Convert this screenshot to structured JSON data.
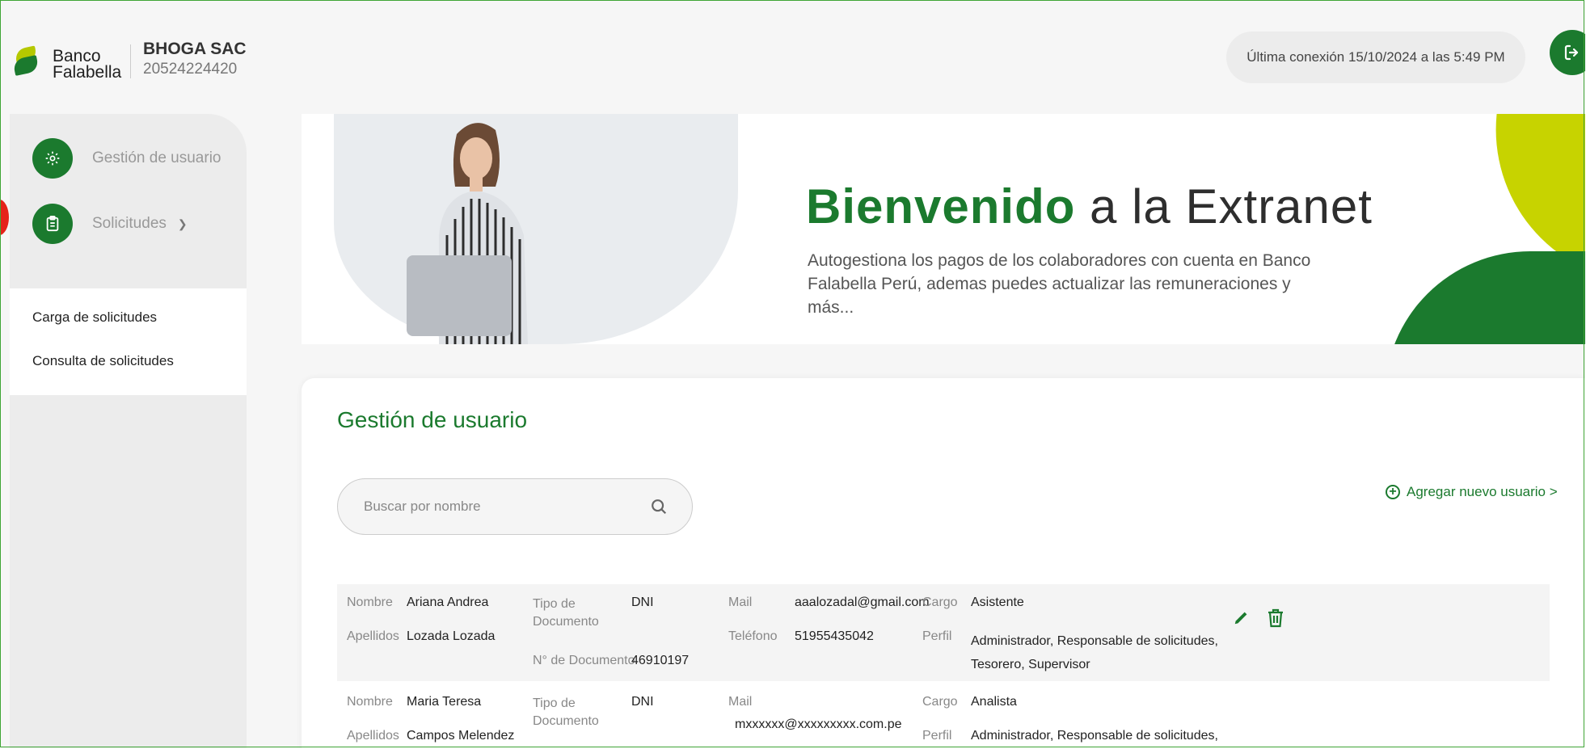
{
  "header": {
    "logo_line1": "Banco",
    "logo_line2": "Falabella",
    "company_name": "BHOGA SAC",
    "company_ruc": "20524224420",
    "last_connection": "Última conexión 15/10/2024 a las 5:49 PM",
    "logout_icon": "logout-icon"
  },
  "sidebar": {
    "items": [
      {
        "label": "Gestión de usuario",
        "icon": "gear-icon"
      },
      {
        "label": "Solicitudes",
        "icon": "clipboard-icon"
      }
    ],
    "subitems": [
      {
        "label": "Carga de solicitudes"
      },
      {
        "label": "Consulta de solicitudes"
      }
    ]
  },
  "banner": {
    "title_bold": "Bienvenido",
    "title_rest": " a la Extranet",
    "subtitle": "Autogestiona los pagos de los colaboradores con cuenta en Banco Falabella Perú, ademas puedes actualizar las remuneraciones y más..."
  },
  "main": {
    "title": "Gestión de usuario",
    "search_placeholder": "Buscar por nombre",
    "add_user": "Agregar nuevo usuario >",
    "labels": {
      "nombre": "Nombre",
      "apellidos": "Apellidos",
      "tipo_doc": "Tipo de Documento",
      "num_doc": "N° de Documento",
      "mail": "Mail",
      "telefono": "Teléfono",
      "cargo": "Cargo",
      "perfil": "Perfil"
    },
    "users": [
      {
        "nombre": "Ariana Andrea",
        "apellidos": "Lozada Lozada",
        "tipo_doc": "DNI",
        "num_doc": "46910197",
        "mail": "aaalozadal@gmail.com",
        "telefono": "51955435042",
        "cargo": "Asistente",
        "perfil": "Administrador,  Responsable de solicitudes, Tesorero,  Supervisor"
      },
      {
        "nombre": "Maria Teresa",
        "apellidos": "Campos Melendez",
        "tipo_doc": "DNI",
        "mail": "mxxxxxx@xxxxxxxxx.com.pe",
        "cargo": "Analista",
        "perfil": "Administrador,  Responsable de solicitudes,"
      }
    ]
  }
}
